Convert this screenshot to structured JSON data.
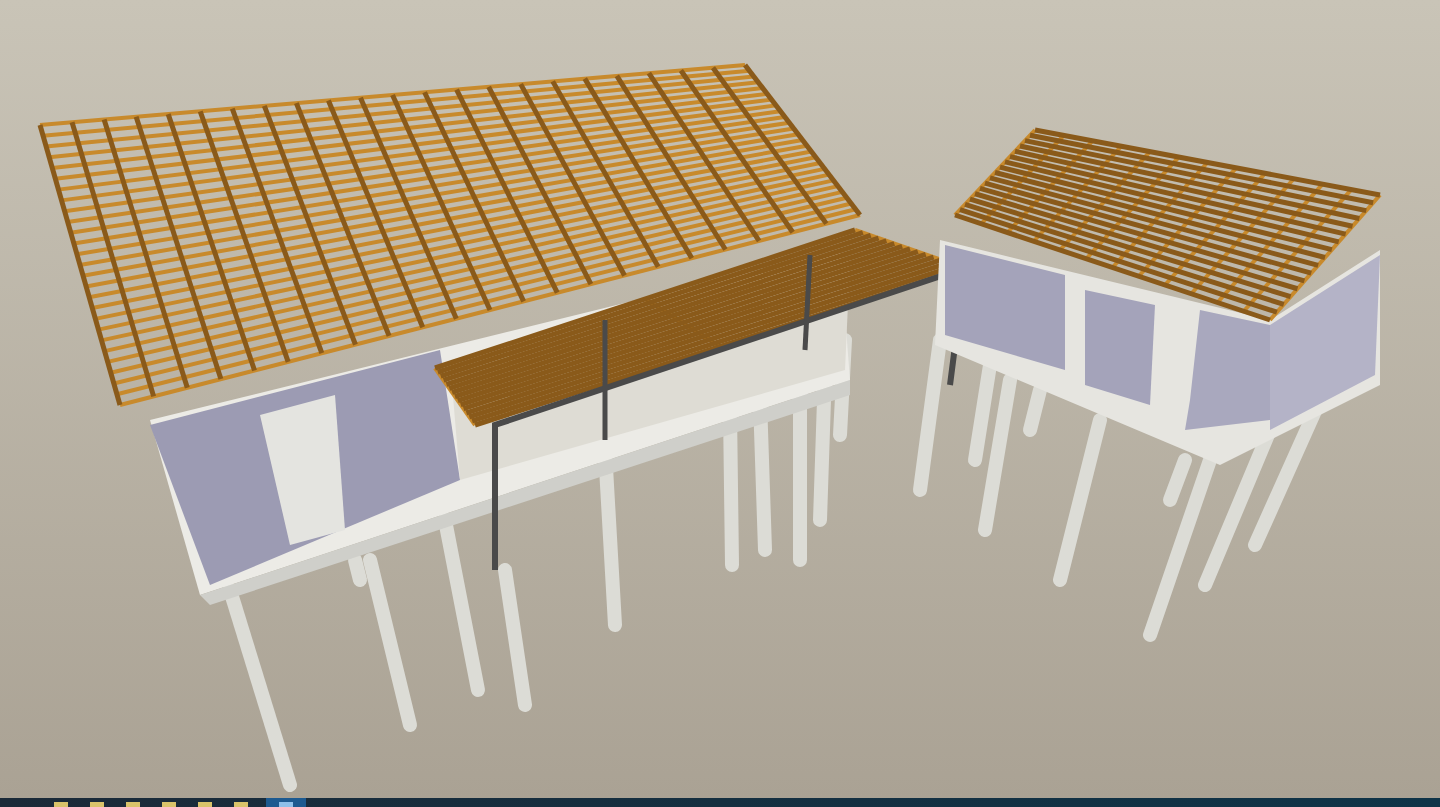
{
  "scene": {
    "buildings": [
      {
        "kind": "large"
      },
      {
        "kind": "small"
      }
    ]
  },
  "taskbar": {
    "items": [
      {
        "selected": false
      },
      {
        "selected": false
      },
      {
        "selected": false
      },
      {
        "selected": false
      },
      {
        "selected": false
      },
      {
        "selected": false
      },
      {
        "selected": true
      }
    ]
  }
}
